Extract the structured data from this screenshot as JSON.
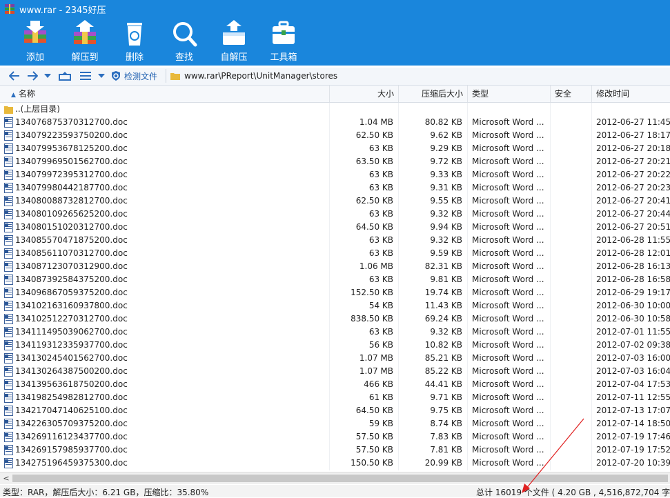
{
  "window": {
    "title": "www.rar - 2345好压"
  },
  "toolbar": {
    "add": "添加",
    "extract": "解压到",
    "delete": "删除",
    "find": "查找",
    "sfx": "自解压",
    "tools": "工具箱"
  },
  "nav": {
    "detect_label": "检测文件",
    "path": "www.rar\\PReport\\UnitManager\\stores"
  },
  "columns": {
    "name": "名称",
    "size": "大小",
    "packed": "压缩后大小",
    "type": "类型",
    "security": "安全",
    "modified": "修改时间"
  },
  "parent_row": {
    "name": "..(上层目录)"
  },
  "files": [
    {
      "name": "134076875370312700.doc",
      "size": "1.04 MB",
      "packed": "80.82 KB",
      "type": "Microsoft Word ...",
      "modified": "2012-06-27 11:45:"
    },
    {
      "name": "134079223593750200.doc",
      "size": "62.50 KB",
      "packed": "9.62 KB",
      "type": "Microsoft Word ...",
      "modified": "2012-06-27 18:17:"
    },
    {
      "name": "134079953678125200.doc",
      "size": "63 KB",
      "packed": "9.29 KB",
      "type": "Microsoft Word ...",
      "modified": "2012-06-27 20:18:"
    },
    {
      "name": "134079969501562700.doc",
      "size": "63.50 KB",
      "packed": "9.72 KB",
      "type": "Microsoft Word ...",
      "modified": "2012-06-27 20:21:"
    },
    {
      "name": "134079972395312700.doc",
      "size": "63 KB",
      "packed": "9.33 KB",
      "type": "Microsoft Word ...",
      "modified": "2012-06-27 20:22:"
    },
    {
      "name": "134079980442187700.doc",
      "size": "63 KB",
      "packed": "9.31 KB",
      "type": "Microsoft Word ...",
      "modified": "2012-06-27 20:23:"
    },
    {
      "name": "134080088732812700.doc",
      "size": "62.50 KB",
      "packed": "9.55 KB",
      "type": "Microsoft Word ...",
      "modified": "2012-06-27 20:41:"
    },
    {
      "name": "134080109265625200.doc",
      "size": "63 KB",
      "packed": "9.32 KB",
      "type": "Microsoft Word ...",
      "modified": "2012-06-27 20:44:"
    },
    {
      "name": "134080151020312700.doc",
      "size": "64.50 KB",
      "packed": "9.94 KB",
      "type": "Microsoft Word ...",
      "modified": "2012-06-27 20:51:"
    },
    {
      "name": "134085570471875200.doc",
      "size": "63 KB",
      "packed": "9.32 KB",
      "type": "Microsoft Word ...",
      "modified": "2012-06-28 11:55:"
    },
    {
      "name": "134085611070312700.doc",
      "size": "63 KB",
      "packed": "9.59 KB",
      "type": "Microsoft Word ...",
      "modified": "2012-06-28 12:01:"
    },
    {
      "name": "134087123070312900.doc",
      "size": "1.06 MB",
      "packed": "82.31 KB",
      "type": "Microsoft Word ...",
      "modified": "2012-06-28 16:13:"
    },
    {
      "name": "134087392584375200.doc",
      "size": "63 KB",
      "packed": "9.81 KB",
      "type": "Microsoft Word ...",
      "modified": "2012-06-28 16:58:"
    },
    {
      "name": "134096867059375200.doc",
      "size": "152.50 KB",
      "packed": "19.74 KB",
      "type": "Microsoft Word ...",
      "modified": "2012-06-29 19:17:"
    },
    {
      "name": "134102163160937800.doc",
      "size": "54 KB",
      "packed": "11.43 KB",
      "type": "Microsoft Word ...",
      "modified": "2012-06-30 10:00:"
    },
    {
      "name": "134102512270312700.doc",
      "size": "838.50 KB",
      "packed": "69.24 KB",
      "type": "Microsoft Word ...",
      "modified": "2012-06-30 10:58:"
    },
    {
      "name": "134111495039062700.doc",
      "size": "63 KB",
      "packed": "9.32 KB",
      "type": "Microsoft Word ...",
      "modified": "2012-07-01 11:55:"
    },
    {
      "name": "134119312335937700.doc",
      "size": "56 KB",
      "packed": "10.82 KB",
      "type": "Microsoft Word ...",
      "modified": "2012-07-02 09:38:"
    },
    {
      "name": "134130245401562700.doc",
      "size": "1.07 MB",
      "packed": "85.21 KB",
      "type": "Microsoft Word ...",
      "modified": "2012-07-03 16:00:"
    },
    {
      "name": "134130264387500200.doc",
      "size": "1.07 MB",
      "packed": "85.22 KB",
      "type": "Microsoft Word ...",
      "modified": "2012-07-03 16:04:"
    },
    {
      "name": "134139563618750200.doc",
      "size": "466 KB",
      "packed": "44.41 KB",
      "type": "Microsoft Word ...",
      "modified": "2012-07-04 17:53:"
    },
    {
      "name": "134198254982812700.doc",
      "size": "61 KB",
      "packed": "9.71 KB",
      "type": "Microsoft Word ...",
      "modified": "2012-07-11 12:55:"
    },
    {
      "name": "134217047140625100.doc",
      "size": "64.50 KB",
      "packed": "9.75 KB",
      "type": "Microsoft Word ...",
      "modified": "2012-07-13 17:07:"
    },
    {
      "name": "134226305709375200.doc",
      "size": "59 KB",
      "packed": "8.74 KB",
      "type": "Microsoft Word ...",
      "modified": "2012-07-14 18:50:"
    },
    {
      "name": "134269116123437700.doc",
      "size": "57.50 KB",
      "packed": "7.83 KB",
      "type": "Microsoft Word ...",
      "modified": "2012-07-19 17:46:"
    },
    {
      "name": "134269157985937700.doc",
      "size": "57.50 KB",
      "packed": "7.81 KB",
      "type": "Microsoft Word ...",
      "modified": "2012-07-19 17:52:"
    },
    {
      "name": "134275196459375300.doc",
      "size": "150.50 KB",
      "packed": "20.99 KB",
      "type": "Microsoft Word ...",
      "modified": "2012-07-20 10:39:"
    }
  ],
  "status": {
    "left": "类型：RAR，解压后大小：6.21 GB，压缩比：35.80%",
    "right": "总计 16019 个文件 ( 4.20 GB , 4,516,872,704 字节"
  },
  "colors": {
    "toolbar_bg": "#1a86dc",
    "annotation_arrow": "#e02020"
  },
  "icons": {
    "app": "rar-app-icon",
    "add": "add-archive-icon",
    "extract": "extract-icon",
    "delete": "recycle-bin-icon",
    "find": "magnifier-icon",
    "sfx": "self-extract-icon",
    "tools": "toolbox-icon",
    "file": "word-doc-icon",
    "folder": "folder-icon"
  }
}
